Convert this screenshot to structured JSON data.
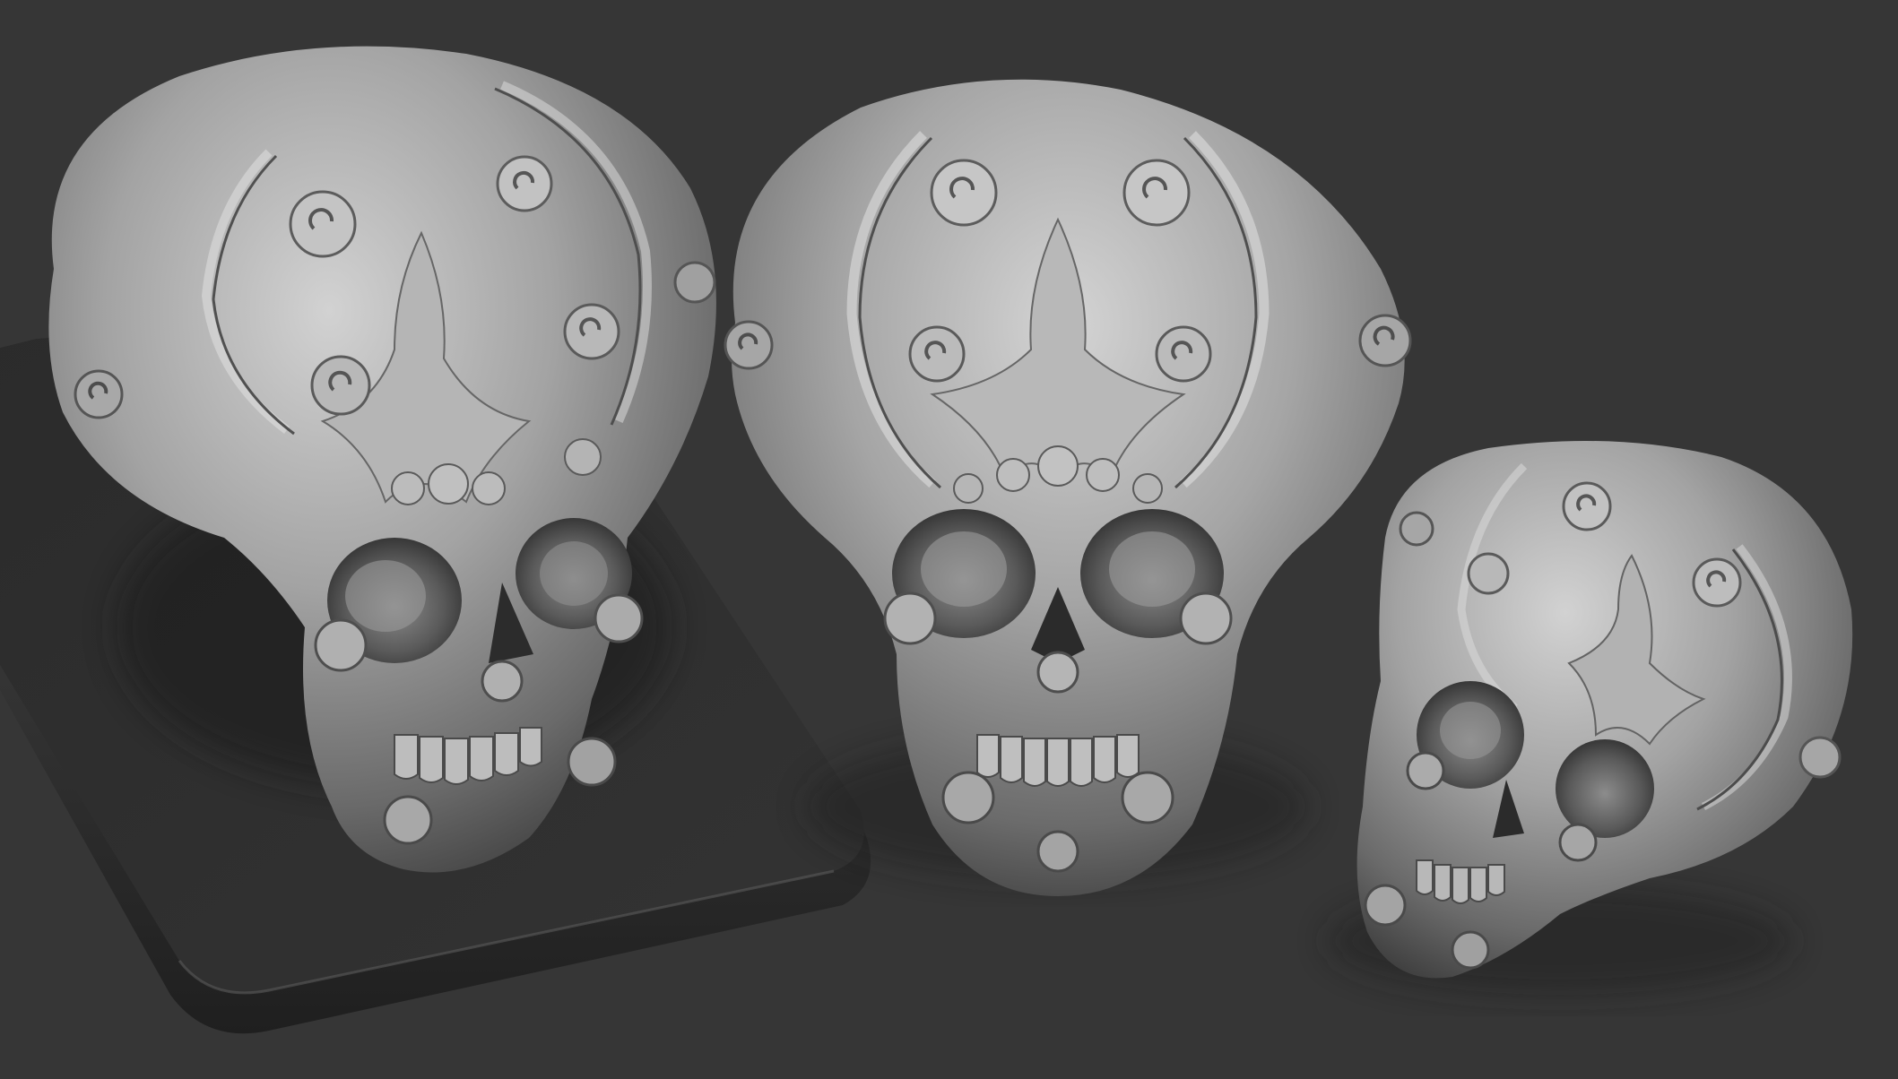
{
  "scene": {
    "background_color": "#363636",
    "material_color": "#9a9a9a",
    "base_color": "#2c2c2c",
    "objects": [
      {
        "name": "skull-on-base",
        "view": "three-quarter"
      },
      {
        "name": "skull-front",
        "view": "front"
      },
      {
        "name": "skull-side",
        "view": "three-quarter-turned"
      }
    ]
  }
}
